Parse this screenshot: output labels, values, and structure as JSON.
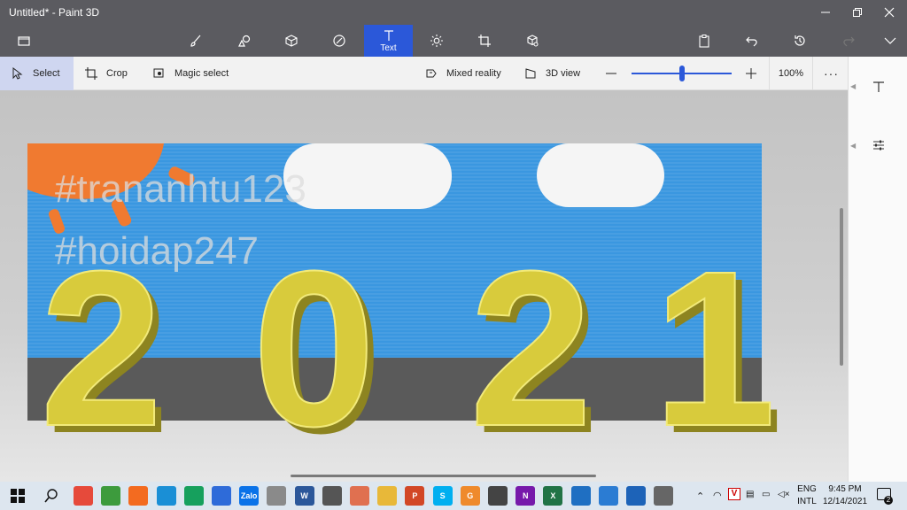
{
  "window": {
    "title": "Untitled* - Paint 3D"
  },
  "ribbon": {
    "menu_icon": "folder-icon",
    "tools": [
      {
        "name": "brushes",
        "icon": "brush-icon"
      },
      {
        "name": "2d-shapes",
        "icon": "2d-shapes-icon"
      },
      {
        "name": "3d-shapes",
        "icon": "cube-icon"
      },
      {
        "name": "stickers",
        "icon": "sticker-icon"
      },
      {
        "name": "text",
        "icon": "text-icon",
        "label": "Text",
        "active": true
      },
      {
        "name": "effects",
        "icon": "sun-icon"
      },
      {
        "name": "canvas",
        "icon": "canvas-icon"
      },
      {
        "name": "3d-library",
        "icon": "library-icon"
      }
    ],
    "right": [
      "paste-icon",
      "undo-icon",
      "history-icon",
      "redo-icon",
      "expand-icon"
    ]
  },
  "toolbar": {
    "select": "Select",
    "crop": "Crop",
    "magic_select": "Magic select",
    "mixed_reality": "Mixed reality",
    "view_3d": "3D view",
    "zoom": "100%",
    "zoom_level": 0.5
  },
  "canvas": {
    "watermark_1": "#trananhtu123",
    "watermark_2": "#hoidap247",
    "big_text": [
      "2",
      "0",
      "2",
      "1"
    ],
    "colors": {
      "sky": "#3a97e0",
      "ground": "#5a5a5a",
      "sun": "#f07a30",
      "gold": "#d8cb3c",
      "cloud": "#f5f5f5"
    }
  },
  "taskbar": {
    "lang_1": "ENG",
    "lang_2": "INTL",
    "time": "9:45 PM",
    "date": "12/14/2021",
    "notifications": "2",
    "apps": [
      {
        "name": "chrome",
        "color": "#e64a3b"
      },
      {
        "name": "coc-coc",
        "color": "#3d9b3d"
      },
      {
        "name": "firefox",
        "color": "#f36b20"
      },
      {
        "name": "edge",
        "color": "#1a8fd6"
      },
      {
        "name": "meet",
        "color": "#16a05d"
      },
      {
        "name": "paint3d",
        "color": "#2e6bd9"
      },
      {
        "name": "zalo",
        "color": "#0a72e8",
        "label": "Zalo"
      },
      {
        "name": "tool",
        "color": "#8a8a8a"
      },
      {
        "name": "word",
        "color": "#2b579a",
        "label": "W"
      },
      {
        "name": "settings",
        "color": "#555555"
      },
      {
        "name": "apps",
        "color": "#e07050"
      },
      {
        "name": "explorer",
        "color": "#e8b839"
      },
      {
        "name": "powerpoint",
        "color": "#d24726",
        "label": "P"
      },
      {
        "name": "skype",
        "color": "#00aff0",
        "label": "S"
      },
      {
        "name": "app-g",
        "color": "#ef8a2c",
        "label": "G"
      },
      {
        "name": "camera",
        "color": "#444444"
      },
      {
        "name": "onenote",
        "color": "#7719aa",
        "label": "N"
      },
      {
        "name": "excel",
        "color": "#217346",
        "label": "X"
      },
      {
        "name": "video",
        "color": "#1f6fc2"
      },
      {
        "name": "onedrive",
        "color": "#2b7cd3"
      },
      {
        "name": "photos",
        "color": "#1d63b8"
      },
      {
        "name": "calculator",
        "color": "#666666"
      }
    ]
  }
}
